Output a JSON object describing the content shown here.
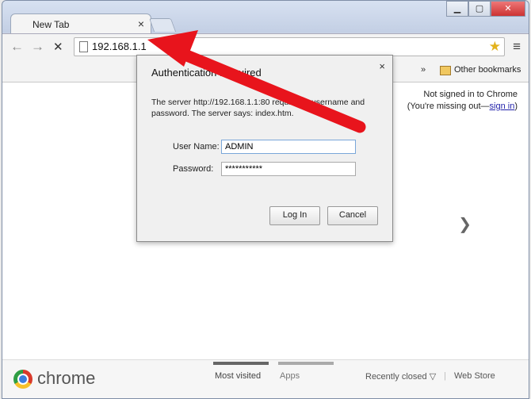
{
  "tab": {
    "title": "New Tab",
    "close": "×"
  },
  "window": {
    "minimize": "▁",
    "maximize": "▢",
    "close": "✕"
  },
  "toolbar": {
    "back": "←",
    "forward": "→",
    "stop": "✕",
    "url": "192.168.1.1",
    "star": "★",
    "menu": "≡"
  },
  "bookmarks": {
    "chevron": "»",
    "other_bookmarks": "Other bookmarks"
  },
  "signin": {
    "line1": "Not signed in to Chrome",
    "line2_prefix": "(You're missing out—",
    "line2_link": "sign in",
    "line2_suffix": ")"
  },
  "content": {
    "next_arrow": "❯"
  },
  "footer": {
    "brand": "chrome",
    "most_visited": "Most visited",
    "apps": "Apps",
    "recently_closed": "Recently closed ▽",
    "separator": "|",
    "web_store": "Web Store"
  },
  "dialog": {
    "title": "Authentication Required",
    "close": "×",
    "message": "The server http://192.168.1.1:80 requires a username and password. The server says: index.htm.",
    "username_label": "User Name:",
    "username_value": "ADMIN",
    "password_label": "Password:",
    "password_value": "***********",
    "login_label": "Log In",
    "cancel_label": "Cancel"
  },
  "colors": {
    "annotation_arrow": "#e8141c",
    "titlebar": "#c9d4e6"
  }
}
